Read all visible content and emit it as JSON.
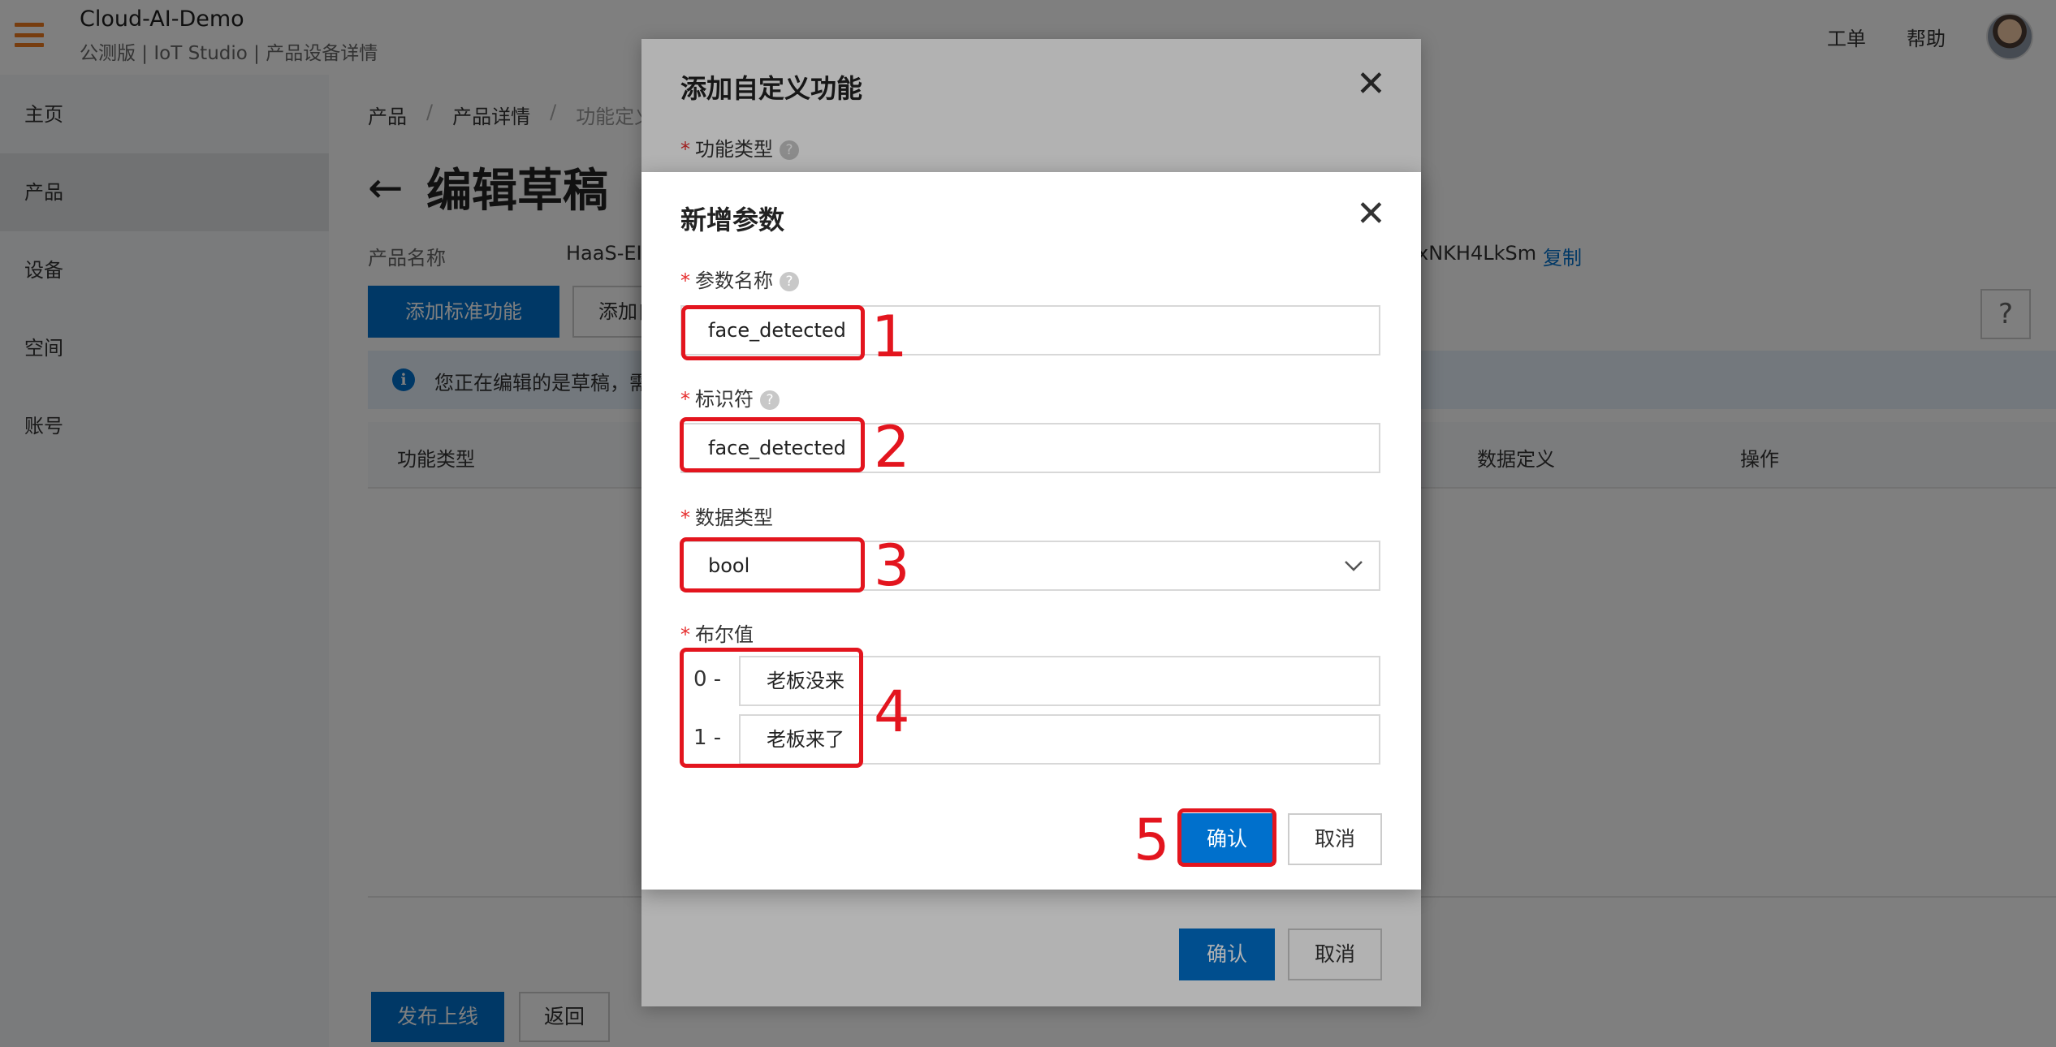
{
  "header": {
    "app_title": "Cloud-AI-Demo",
    "app_subtitle": "公测版 | IoT Studio | 产品设备详情",
    "links": [
      "工单",
      "帮助"
    ]
  },
  "sidebar": {
    "items": [
      {
        "label": "主页"
      },
      {
        "label": "产品"
      },
      {
        "label": "设备"
      },
      {
        "label": "空间"
      },
      {
        "label": "账号"
      }
    ],
    "active_index": 1
  },
  "main": {
    "breadcrumb": [
      "产品",
      "产品详情",
      "功能定义"
    ],
    "page_title": "编辑草稿",
    "product_name_label": "产品名称",
    "product_name_value": "HaaS-EI",
    "product_key_partial": "xNKH4LkSm",
    "copy_label": "复制",
    "add_standard_button": "添加标准功能",
    "add_custom_button": "添加自",
    "help_icon_text": "?",
    "notice_text": "您正在编辑的是草稿，需",
    "table_headers": [
      "功能类型",
      "数据定义",
      "操作"
    ],
    "publish_button": "发布上线",
    "return_button": "返回"
  },
  "outer_dialog": {
    "title": "添加自定义功能",
    "field_label": "功能类型",
    "confirm": "确认",
    "cancel": "取消"
  },
  "inner_dialog": {
    "title": "新增参数",
    "param_name_label": "参数名称",
    "param_name_value": "face_detected",
    "identifier_label": "标识符",
    "identifier_value": "face_detected",
    "data_type_label": "数据类型",
    "data_type_value": "bool",
    "bool_label": "布尔值",
    "bool_values": [
      {
        "prefix": "0 -",
        "value": "老板没来"
      },
      {
        "prefix": "1 -",
        "value": "老板来了"
      }
    ],
    "confirm": "确认",
    "cancel": "取消"
  },
  "annotations": [
    "1",
    "2",
    "3",
    "4",
    "5"
  ],
  "colors": {
    "primary": "#0070cc",
    "annotation": "#e3151e",
    "brand_orange": "#ee7a1e",
    "required": "#e62e2e"
  }
}
